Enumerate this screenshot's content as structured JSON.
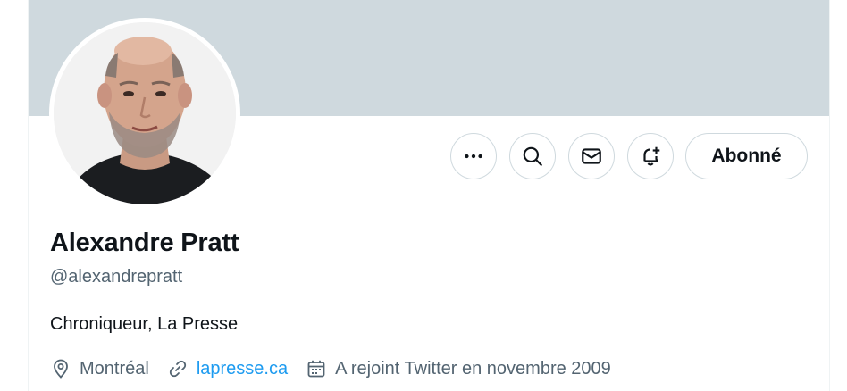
{
  "profile": {
    "name": "Alexandre Pratt",
    "handle": "@alexandrepratt",
    "bio": "Chroniqueur, La Presse",
    "location": "Montréal",
    "website": "lapresse.ca",
    "joined": "A rejoint Twitter en novembre 2009"
  },
  "actions": {
    "follow_label": "Abonné"
  },
  "colors": {
    "banner": "#cfd9de",
    "link": "#1d9bf0",
    "secondary_text": "#536471",
    "primary_text": "#0f1419"
  },
  "icons": [
    "more-icon",
    "search-icon",
    "mail-icon",
    "notification-bell-plus-icon",
    "location-pin-icon",
    "link-icon",
    "calendar-icon"
  ]
}
